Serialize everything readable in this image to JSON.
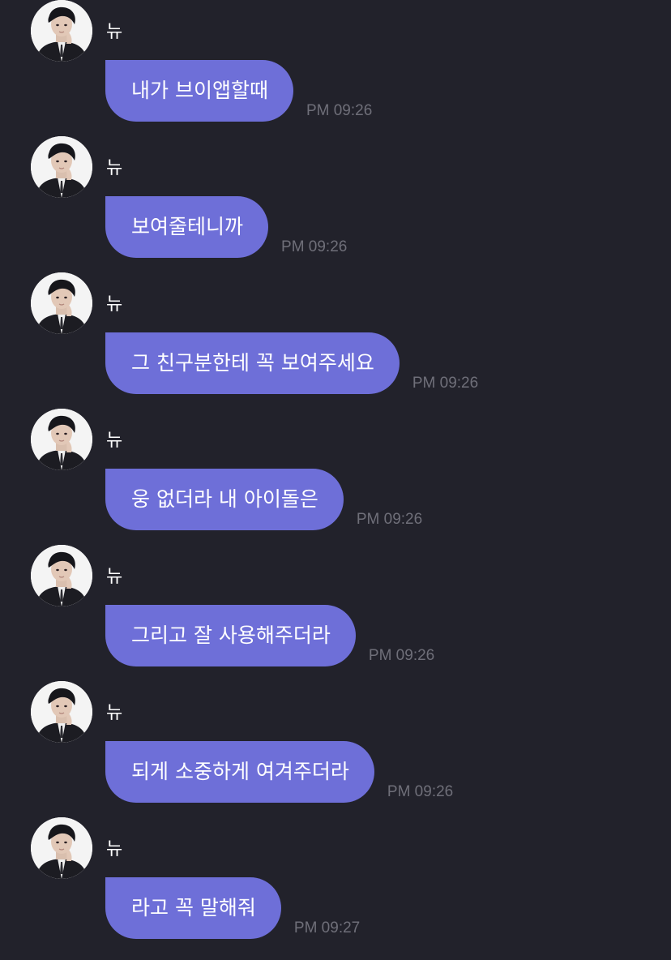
{
  "chat": {
    "messages": [
      {
        "sender": "뉴",
        "text": "내가 브이앱할때",
        "time": "PM 09:26"
      },
      {
        "sender": "뉴",
        "text": "보여줄테니까",
        "time": "PM 09:26"
      },
      {
        "sender": "뉴",
        "text": "그 친구분한테 꼭 보여주세요",
        "time": "PM 09:26"
      },
      {
        "sender": "뉴",
        "text": "웅 없더라 내 아이돌은",
        "time": "PM 09:26"
      },
      {
        "sender": "뉴",
        "text": "그리고 잘 사용해주더라",
        "time": "PM 09:26"
      },
      {
        "sender": "뉴",
        "text": "되게 소중하게 여겨주더라",
        "time": "PM 09:26"
      },
      {
        "sender": "뉴",
        "text": "라고 꼭 말해줘",
        "time": "PM 09:27"
      }
    ]
  },
  "colors": {
    "background": "#22222b",
    "bubble": "#6e6fd8",
    "timestamp": "#6f6f79",
    "text": "#ffffff"
  }
}
